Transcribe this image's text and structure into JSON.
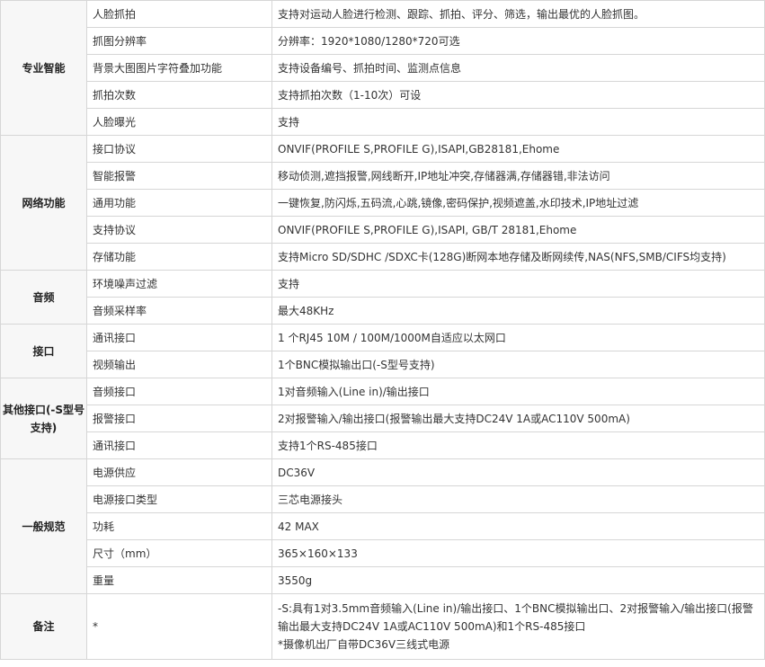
{
  "sections": [
    {
      "category": "专业智能",
      "rows": [
        {
          "name": "人脸抓拍",
          "value": "支持对运动人脸进行检测、跟踪、抓拍、评分、筛选，输出最优的人脸抓图。"
        },
        {
          "name": "抓图分辨率",
          "value": "分辨率：1920*1080/1280*720可选"
        },
        {
          "name": "背景大图图片字符叠加功能",
          "value": "支持设备编号、抓拍时间、监测点信息"
        },
        {
          "name": "抓拍次数",
          "value": "支持抓拍次数（1-10次）可设"
        },
        {
          "name": "人脸曝光",
          "value": "支持"
        }
      ]
    },
    {
      "category": "网络功能",
      "rows": [
        {
          "name": "接口协议",
          "value": "ONVIF(PROFILE S,PROFILE G),ISAPI,GB28181,Ehome"
        },
        {
          "name": "智能报警",
          "value": "移动侦测,遮挡报警,网线断开,IP地址冲突,存储器满,存储器错,非法访问"
        },
        {
          "name": "通用功能",
          "value": "一键恢复,防闪烁,五码流,心跳,镜像,密码保护,视频遮盖,水印技术,IP地址过滤"
        },
        {
          "name": "支持协议",
          "value": "ONVIF(PROFILE S,PROFILE G),ISAPI, GB/T 28181,Ehome"
        },
        {
          "name": "存储功能",
          "value": "支持Micro SD/SDHC /SDXC卡(128G)断网本地存储及断网续传,NAS(NFS,SMB/CIFS均支持)"
        }
      ]
    },
    {
      "category": "音频",
      "rows": [
        {
          "name": "环境噪声过滤",
          "value": "支持"
        },
        {
          "name": "音频采样率",
          "value": "最大48KHz"
        }
      ]
    },
    {
      "category": "接口",
      "rows": [
        {
          "name": "通讯接口",
          "value": "1 个RJ45 10M / 100M/1000M自适应以太网口"
        },
        {
          "name": "视频输出",
          "value": "1个BNC模拟输出口(-S型号支持)"
        }
      ]
    },
    {
      "category": "其他接口(-S型号支持)",
      "rows": [
        {
          "name": "音频接口",
          "value": "1对音频输入(Line in)/输出接口"
        },
        {
          "name": "报警接口",
          "value": "2对报警输入/输出接口(报警输出最大支持DC24V 1A或AC110V 500mA)"
        },
        {
          "name": "通讯接口",
          "value": "支持1个RS-485接口"
        }
      ]
    },
    {
      "category": "一般规范",
      "rows": [
        {
          "name": "电源供应",
          "value": "DC36V"
        },
        {
          "name": "电源接口类型",
          "value": "三芯电源接头"
        },
        {
          "name": "功耗",
          "value": "42 MAX"
        },
        {
          "name": "尺寸（mm）",
          "value": "365×160×133"
        },
        {
          "name": "重量",
          "value": "3550g"
        }
      ]
    }
  ],
  "notes": {
    "category": "备注",
    "name": "*",
    "line1": "-S:具有1对3.5mm音频输入(Line in)/输出接口、1个BNC模拟输出口、2对报警输入/输出接口(报警输出最大支持DC24V 1A或AC110V 500mA)和1个RS-485接口",
    "line2": "*摄像机出厂自带DC36V三线式电源"
  }
}
